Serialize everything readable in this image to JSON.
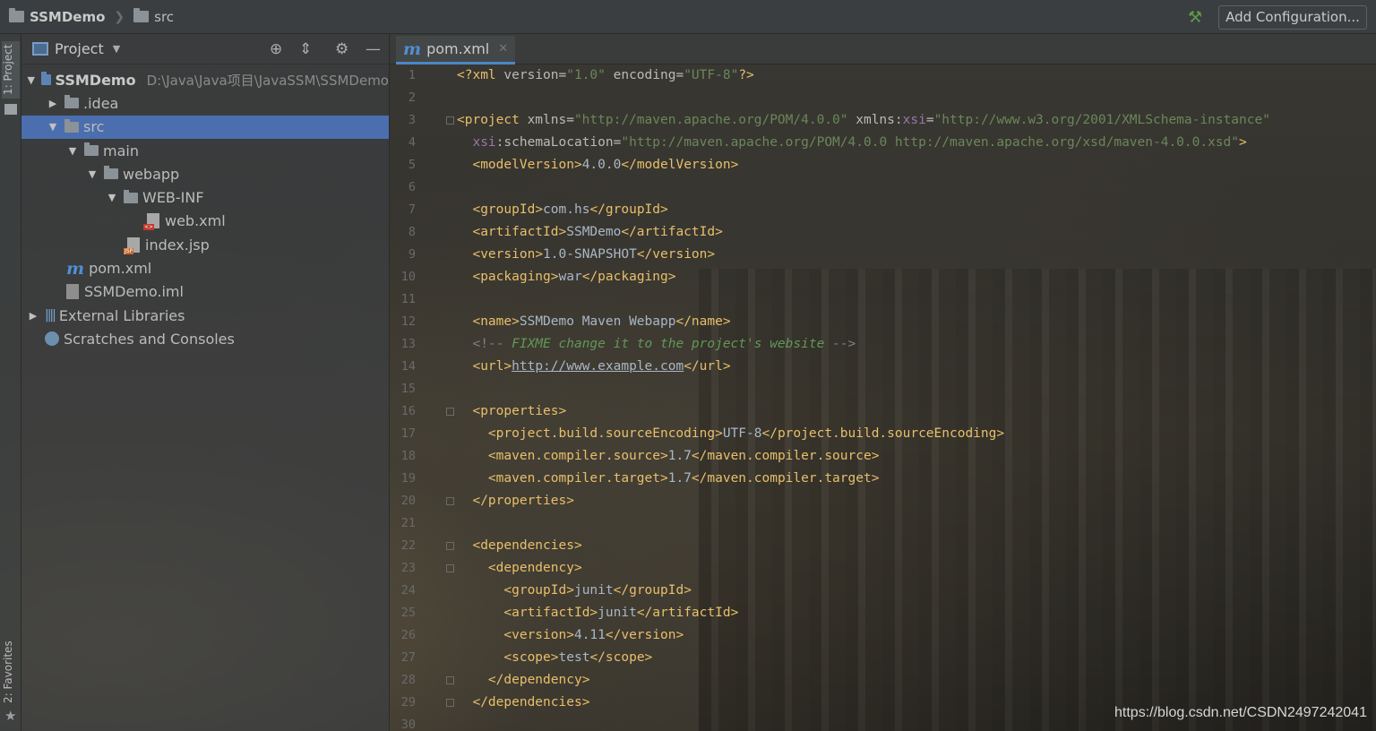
{
  "titlebar": {
    "project_name": "SSMDemo",
    "path_segment": "src",
    "add_configuration": "Add Configuration..."
  },
  "side_strip": {
    "project_tab": "1: Project",
    "favorites_tab": "2: Favorites"
  },
  "project_panel": {
    "header": "Project",
    "tree": [
      {
        "label": "SSMDemo",
        "extra": "D:\\Java\\Java项目\\JavaSSM\\SSMDemo",
        "type": "module",
        "expanded": true
      },
      {
        "label": ".idea",
        "type": "folder",
        "expanded": false
      },
      {
        "label": "src",
        "type": "folder",
        "expanded": true,
        "selected": true
      },
      {
        "label": "main",
        "type": "folder",
        "expanded": true
      },
      {
        "label": "webapp",
        "type": "folder",
        "expanded": true
      },
      {
        "label": "WEB-INF",
        "type": "folder",
        "expanded": true
      },
      {
        "label": "web.xml",
        "type": "xml"
      },
      {
        "label": "index.jsp",
        "type": "jsp"
      },
      {
        "label": "pom.xml",
        "type": "maven"
      },
      {
        "label": "SSMDemo.iml",
        "type": "iml"
      },
      {
        "label": "External Libraries",
        "type": "libraries",
        "expanded": false
      },
      {
        "label": "Scratches and Consoles",
        "type": "scratches"
      }
    ]
  },
  "editor": {
    "tab_label": "pom.xml",
    "line_numbers": [
      "1",
      "2",
      "3",
      "4",
      "5",
      "6",
      "7",
      "8",
      "9",
      "10",
      "11",
      "12",
      "13",
      "14",
      "15",
      "16",
      "17",
      "18",
      "19",
      "20",
      "21",
      "22",
      "23",
      "24",
      "25",
      "26",
      "27",
      "28",
      "29",
      "30"
    ],
    "lines": [
      "<?xml version=\"1.0\" encoding=\"UTF-8\"?>",
      "",
      "<project xmlns=\"http://maven.apache.org/POM/4.0.0\" xmlns:xsi=\"http://www.w3.org/2001/XMLSchema-instance\"",
      "  xsi:schemaLocation=\"http://maven.apache.org/POM/4.0.0 http://maven.apache.org/xsd/maven-4.0.0.xsd\">",
      "  <modelVersion>4.0.0</modelVersion>",
      "",
      "  <groupId>com.hs</groupId>",
      "  <artifactId>SSMDemo</artifactId>",
      "  <version>1.0-SNAPSHOT</version>",
      "  <packaging>war</packaging>",
      "",
      "  <name>SSMDemo Maven Webapp</name>",
      "  <!-- FIXME change it to the project's website -->",
      "  <url>http://www.example.com</url>",
      "",
      "  <properties>",
      "    <project.build.sourceEncoding>UTF-8</project.build.sourceEncoding>",
      "    <maven.compiler.source>1.7</maven.compiler.source>",
      "    <maven.compiler.target>1.7</maven.compiler.target>",
      "  </properties>",
      "",
      "  <dependencies>",
      "    <dependency>",
      "      <groupId>junit</groupId>",
      "      <artifactId>junit</artifactId>",
      "      <version>4.11</version>",
      "      <scope>test</scope>",
      "    </dependency>",
      "  </dependencies>",
      ""
    ]
  },
  "watermark": "https://blog.csdn.net/CSDN2497242041",
  "colors": {
    "selection": "#4b6eaf",
    "tag": "#e8bf6a",
    "attr_value": "#6a8759",
    "namespace": "#9876aa",
    "comment": "#629755",
    "maven_icon": "#4f8fd6",
    "run_hammer": "#5d9b47"
  },
  "icons": [
    "folder-icon",
    "hammer-icon",
    "project-view-icon",
    "locate-icon",
    "collapse-all-icon",
    "gear-icon",
    "minimize-icon",
    "maven-icon",
    "close-icon",
    "star-icon"
  ]
}
